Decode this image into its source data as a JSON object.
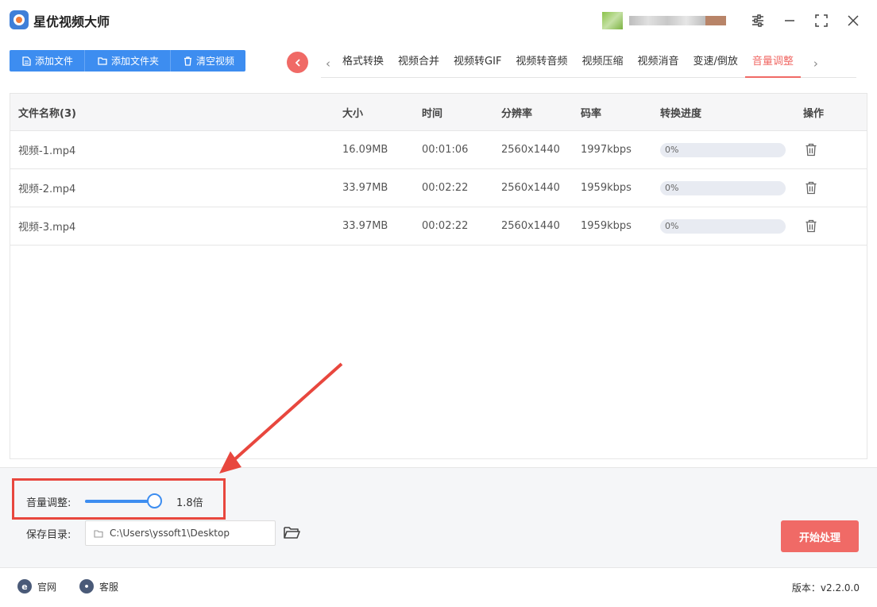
{
  "app": {
    "title": "星优视频大师"
  },
  "toolbar": {
    "add_file": "添加文件",
    "add_folder": "添加文件夹",
    "clear": "清空视频"
  },
  "tabs": {
    "prev": "‹",
    "next": "›",
    "items": [
      "格式转换",
      "视频合并",
      "视频转GIF",
      "视频转音频",
      "视频压缩",
      "视频消音",
      "变速/倒放",
      "音量调整"
    ],
    "active": "音量调整"
  },
  "table": {
    "headers": {
      "name": "文件名称(3)",
      "size": "大小",
      "time": "时间",
      "resolution": "分辨率",
      "bitrate": "码率",
      "progress": "转换进度",
      "action": "操作"
    },
    "rows": [
      {
        "name": "视频-1.mp4",
        "size": "16.09MB",
        "time": "00:01:06",
        "resolution": "2560x1440",
        "bitrate": "1997kbps",
        "progress": "0%"
      },
      {
        "name": "视频-2.mp4",
        "size": "33.97MB",
        "time": "00:02:22",
        "resolution": "2560x1440",
        "bitrate": "1959kbps",
        "progress": "0%"
      },
      {
        "name": "视频-3.mp4",
        "size": "33.97MB",
        "time": "00:02:22",
        "resolution": "2560x1440",
        "bitrate": "1959kbps",
        "progress": "0%"
      }
    ]
  },
  "settings": {
    "volume_label": "音量调整:",
    "volume_value": "1.8倍",
    "volume_level": 0.9,
    "save_label": "保存目录:",
    "save_path": "C:\\Users\\yssoft1\\Desktop",
    "start_button": "开始处理"
  },
  "footer": {
    "website": "官网",
    "support": "客服",
    "version": "版本：v2.2.0.0"
  },
  "colors": {
    "primary": "#3d8df0",
    "accent": "#f06a66",
    "highlight_box": "#e8473e"
  }
}
